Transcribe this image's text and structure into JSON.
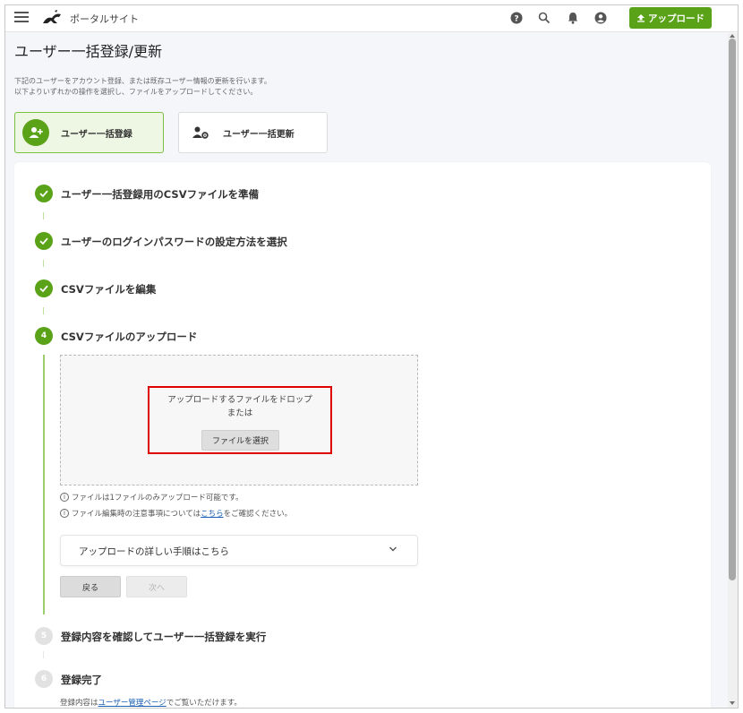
{
  "header": {
    "site_title": "ポータルサイト",
    "upload_label": "アップロード",
    "icons": [
      "menu-icon",
      "logo-icon",
      "help-icon",
      "search-icon",
      "bell-icon",
      "account-icon",
      "upload-icon"
    ]
  },
  "page": {
    "title": "ユーザー一括登録/更新",
    "description_line1": "下記のユーザーをアカウント登録、または既存ユーザー情報の更新を行います。",
    "description_line2": "以下よりいずれかの操作を選択し、ファイルをアップロードしてください。"
  },
  "tabs": [
    {
      "label": "ユーザー一括登録",
      "icon": "user-add-icon",
      "selected": true
    },
    {
      "label": "ユーザー一括更新",
      "icon": "user-settings-icon",
      "selected": false
    }
  ],
  "steps": [
    {
      "label": "ユーザー一括登録用のCSVファイルを準備",
      "status": "done"
    },
    {
      "label": "ユーザーのログインパスワードの設定方法を選択",
      "status": "done"
    },
    {
      "label": "CSVファイルを編集",
      "status": "done"
    },
    {
      "number": "4",
      "label": "CSVファイルのアップロード",
      "status": "active"
    },
    {
      "number": "5",
      "label": "登録内容を確認してユーザー一括登録を実行",
      "status": "pending"
    },
    {
      "number": "6",
      "label": "登録完了",
      "status": "pending"
    }
  ],
  "upload": {
    "drop_text": "アップロードするファイルをドロップ",
    "or_text": "または",
    "choose_button": "ファイルを選択",
    "note1": "ファイルは1ファイルのみアップロード可能です。",
    "note2_prefix": "ファイル編集時の注意事項については",
    "note2_link": "こちら",
    "note2_suffix": "をご確認ください。",
    "accordion_label": "アップロードの詳しい手順はこちら",
    "back_button": "戻る",
    "next_button": "次へ"
  },
  "complete": {
    "prefix": "登録内容は",
    "link": "ユーザー管理ページ",
    "suffix": "でご覧いただけます。"
  },
  "colors": {
    "accent_green": "#5aa319",
    "highlight_red": "#e00000",
    "link_blue": "#1a5fb4"
  }
}
